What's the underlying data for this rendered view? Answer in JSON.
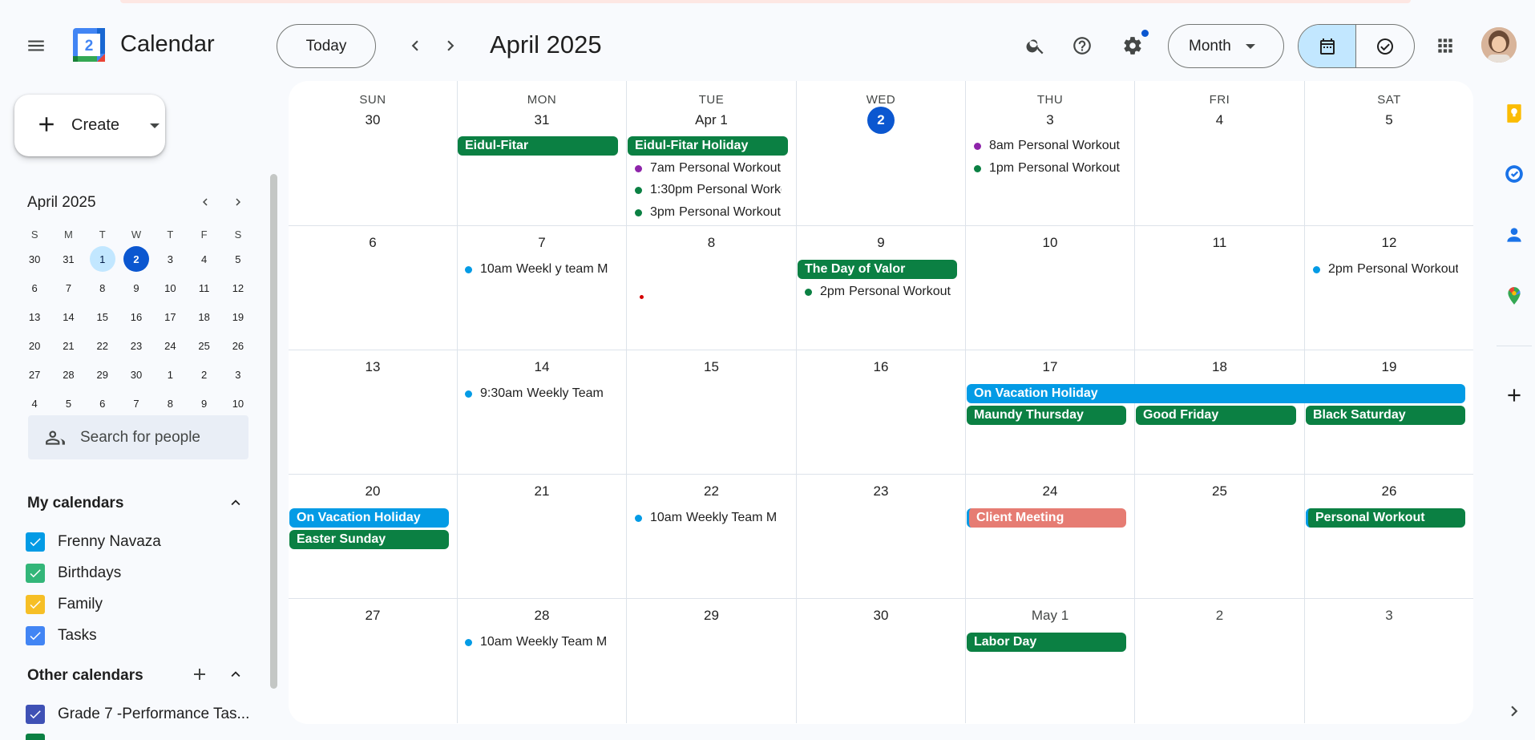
{
  "app": {
    "title": "Calendar",
    "logo_day": "2"
  },
  "header": {
    "today_label": "Today",
    "month_title": "April 2025",
    "view_label": "Month"
  },
  "create": {
    "label": "Create"
  },
  "mini": {
    "title": "April 2025",
    "weekdays": [
      "S",
      "M",
      "T",
      "W",
      "T",
      "F",
      "S"
    ],
    "weeks": [
      [
        "30",
        "31",
        "1",
        "2",
        "3",
        "4",
        "5"
      ],
      [
        "6",
        "7",
        "8",
        "9",
        "10",
        "11",
        "12"
      ],
      [
        "13",
        "14",
        "15",
        "16",
        "17",
        "18",
        "19"
      ],
      [
        "20",
        "21",
        "22",
        "23",
        "24",
        "25",
        "26"
      ],
      [
        "27",
        "28",
        "29",
        "30",
        "1",
        "2",
        "3"
      ],
      [
        "4",
        "5",
        "6",
        "7",
        "8",
        "9",
        "10"
      ]
    ]
  },
  "people_search": {
    "placeholder": "Search for people"
  },
  "my_calendars": {
    "title": "My calendars",
    "items": [
      {
        "name": "Frenny Navaza",
        "color": "#039be5"
      },
      {
        "name": "Birthdays",
        "color": "#33b679"
      },
      {
        "name": "Family",
        "color": "#f6bf26"
      },
      {
        "name": "Tasks",
        "color": "#4285f4"
      }
    ]
  },
  "other_calendars": {
    "title": "Other calendars",
    "items": [
      {
        "name": "Grade 7 -Performance Tas...",
        "color": "#3f51b5"
      }
    ]
  },
  "grid": {
    "weekdays": [
      "SUN",
      "MON",
      "TUE",
      "WED",
      "THU",
      "FRI",
      "SAT"
    ],
    "weeks": [
      [
        "30",
        "31",
        "Apr 1",
        "2",
        "3",
        "4",
        "5"
      ],
      [
        "6",
        "7",
        "8",
        "9",
        "10",
        "11",
        "12"
      ],
      [
        "13",
        "14",
        "15",
        "16",
        "17",
        "18",
        "19"
      ],
      [
        "20",
        "21",
        "22",
        "23",
        "24",
        "25",
        "26"
      ],
      [
        "27",
        "28",
        "29",
        "30",
        "May 1",
        "2",
        "3"
      ]
    ]
  },
  "events": {
    "eidul_fitar": "Eidul-Fitar",
    "eidul_fitar_holiday": "Eidul-Fitar Holiday",
    "tue1_a_time": "7am",
    "tue1_a_title": "Personal Workout",
    "tue1_b_time": "1:30pm",
    "tue1_b_title": "Personal Workout",
    "tue1_c_time": "3pm",
    "tue1_c_title": "Personal Workout",
    "thu3_a_time": "8am",
    "thu3_a_title": "Personal Workout",
    "thu3_b_time": "1pm",
    "thu3_b_title": "Personal Workout",
    "mon7_time": "10am",
    "mon7_title": "Weekl y team M",
    "day_of_valor": "The Day of Valor",
    "wed9_time": "2pm",
    "wed9_title": "Personal Workout",
    "sat12_time": "2pm",
    "sat12_title": "Personal Workout",
    "mon14_time": "9:30am",
    "mon14_title": "Weekly Team",
    "on_vacation_1": "On Vacation Holiday",
    "maundy_thursday": "Maundy Thursday",
    "good_friday": "Good Friday",
    "black_saturday": "Black Saturday",
    "on_vacation_2": "On Vacation Holiday",
    "easter_sunday": "Easter Sunday",
    "tue22_time": "10am",
    "tue22_title": "Weekly Team M",
    "client_meeting": "Client Meeting",
    "personal_workout_26": "Personal Workout",
    "mon28_time": "10am",
    "mon28_title": "Weekly Team M",
    "labor_day": "Labor Day"
  }
}
